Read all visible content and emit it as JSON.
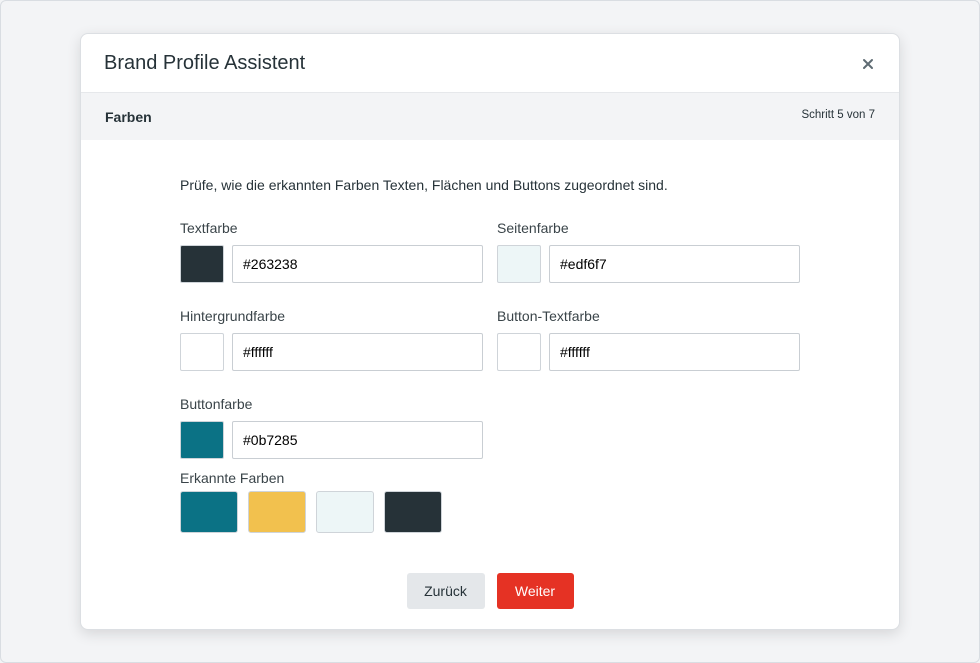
{
  "dialog": {
    "title": "Brand Profile Assistent",
    "close_symbol": "×"
  },
  "step": {
    "title": "Farben",
    "counter": "Schritt 5 von 7"
  },
  "intro_text": "Prüfe, wie die erkannten Farben Texten, Flächen und Buttons zugeordnet sind.",
  "fields": [
    {
      "label": "Textfarbe",
      "value": "#263238",
      "color": "#263238"
    },
    {
      "label": "Seitenfarbe",
      "value": "#edf6f7",
      "color": "#edf6f7"
    },
    {
      "label": "Hintergrundfarbe",
      "value": "#ffffff",
      "color": "#ffffff"
    },
    {
      "label": "Button-Textfarbe",
      "value": "#ffffff",
      "color": "#ffffff"
    },
    {
      "label": "Buttonfarbe",
      "value": "#0b7285",
      "color": "#0b7285"
    }
  ],
  "detected": {
    "label": "Erkannte Farben",
    "colors": [
      "#0b7285",
      "#f2c14e",
      "#edf6f7",
      "#263238"
    ]
  },
  "buttons": {
    "back": "Zurück",
    "next": "Weiter"
  },
  "theme": {
    "accent": "#e53224",
    "text": "#263238",
    "secondary_button": "#e4e7ea"
  }
}
